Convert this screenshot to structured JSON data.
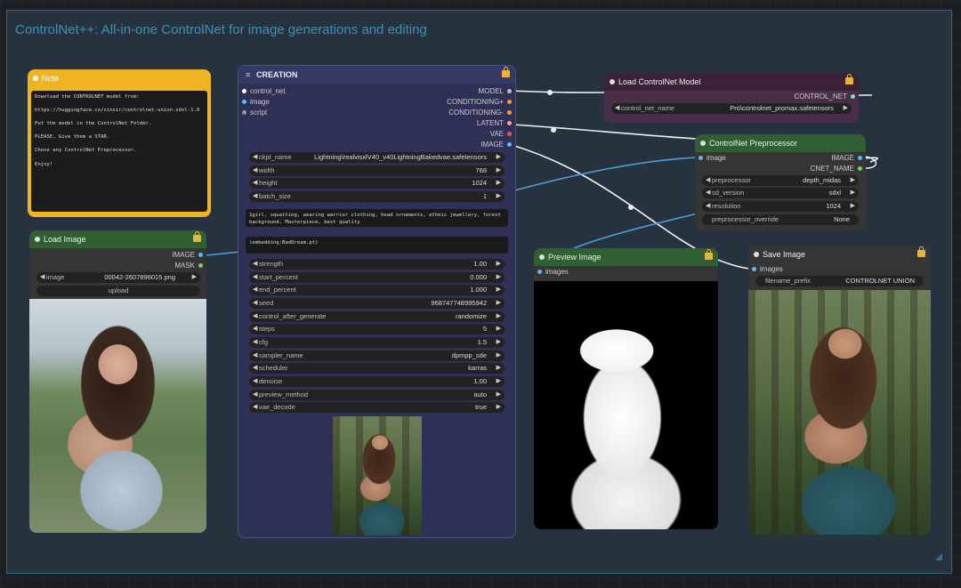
{
  "group": {
    "title": "ControlNet++: All-in-one ControlNet for image generations and editing"
  },
  "colors": {
    "group_border": "#35617a",
    "note_header": "#f0b420",
    "creation_bg": "#2f3056",
    "green_header": "#2f5f33",
    "purple_node": "#4a2d48"
  },
  "note": {
    "title": "Note",
    "lines": [
      "Download the CONTROLNET model from:",
      "https://huggingface.co/xinsir/controlnet-union-sdxl-1.0",
      "Put the model in the ControlNet Folder.",
      "PLEASE, Give them a STAR.",
      "Chose any ControlNet Preprocessor.",
      "Enjoy!"
    ]
  },
  "load_image": {
    "title": "Load Image",
    "outputs": [
      "IMAGE",
      "MASK"
    ],
    "image_label": "image",
    "image_value": "00042-2607896015.png",
    "upload_label": "upload"
  },
  "creation": {
    "title": "CREATION",
    "inputs": [
      "control_net",
      "image",
      "script"
    ],
    "outputs": [
      "MODEL",
      "CONDITIONING+",
      "CONDITIONING-",
      "LATENT",
      "VAE",
      "IMAGE"
    ],
    "widgets_top": [
      {
        "label": "ckpt_name",
        "value": "Lightning\\realvisxlV40_v40LightningBakedvae.safetensors"
      },
      {
        "label": "width",
        "value": "768"
      },
      {
        "label": "height",
        "value": "1024"
      },
      {
        "label": "batch_size",
        "value": "1"
      }
    ],
    "positive_prompt": "1girl, squatting, wearing warrior clothing, head ornaments, ethnic jewellery, forest background, Masterpiece, best quality",
    "negative_prompt": "(embedding:BadDream.pt)",
    "widgets_bottom": [
      {
        "label": "strength",
        "value": "1.00"
      },
      {
        "label": "start_percent",
        "value": "0.000"
      },
      {
        "label": "end_percent",
        "value": "1.000"
      },
      {
        "label": "seed",
        "value": "968747748995942"
      },
      {
        "label": "control_after_generate",
        "value": "randomize"
      },
      {
        "label": "steps",
        "value": "5"
      },
      {
        "label": "cfg",
        "value": "1.5"
      },
      {
        "label": "sampler_name",
        "value": "dpmpp_sde"
      },
      {
        "label": "scheduler",
        "value": "karras"
      },
      {
        "label": "denoise",
        "value": "1.00"
      },
      {
        "label": "preview_method",
        "value": "auto"
      },
      {
        "label": "vae_decode",
        "value": "true"
      }
    ]
  },
  "load_controlnet": {
    "title": "Load ControlNet Model",
    "output": "CONTROL_NET",
    "widget_label": "control_net_name",
    "widget_value": "Pro\\controlnet_promax.safetensors"
  },
  "preprocessor": {
    "title": "ControlNet Preprocessor",
    "input": "image",
    "outputs": [
      "IMAGE",
      "CNET_NAME"
    ],
    "widgets": [
      {
        "label": "preprocessor",
        "value": "depth_midas"
      },
      {
        "label": "sd_version",
        "value": "sdxl"
      },
      {
        "label": "resolution",
        "value": "1024"
      }
    ],
    "override_label": "preprocessor_override",
    "override_value": "None"
  },
  "preview": {
    "title": "Preview Image",
    "input": "images"
  },
  "save": {
    "title": "Save Image",
    "input": "images",
    "prefix_label": "filename_prefix",
    "prefix_value": "CONTROLNET UNION"
  }
}
